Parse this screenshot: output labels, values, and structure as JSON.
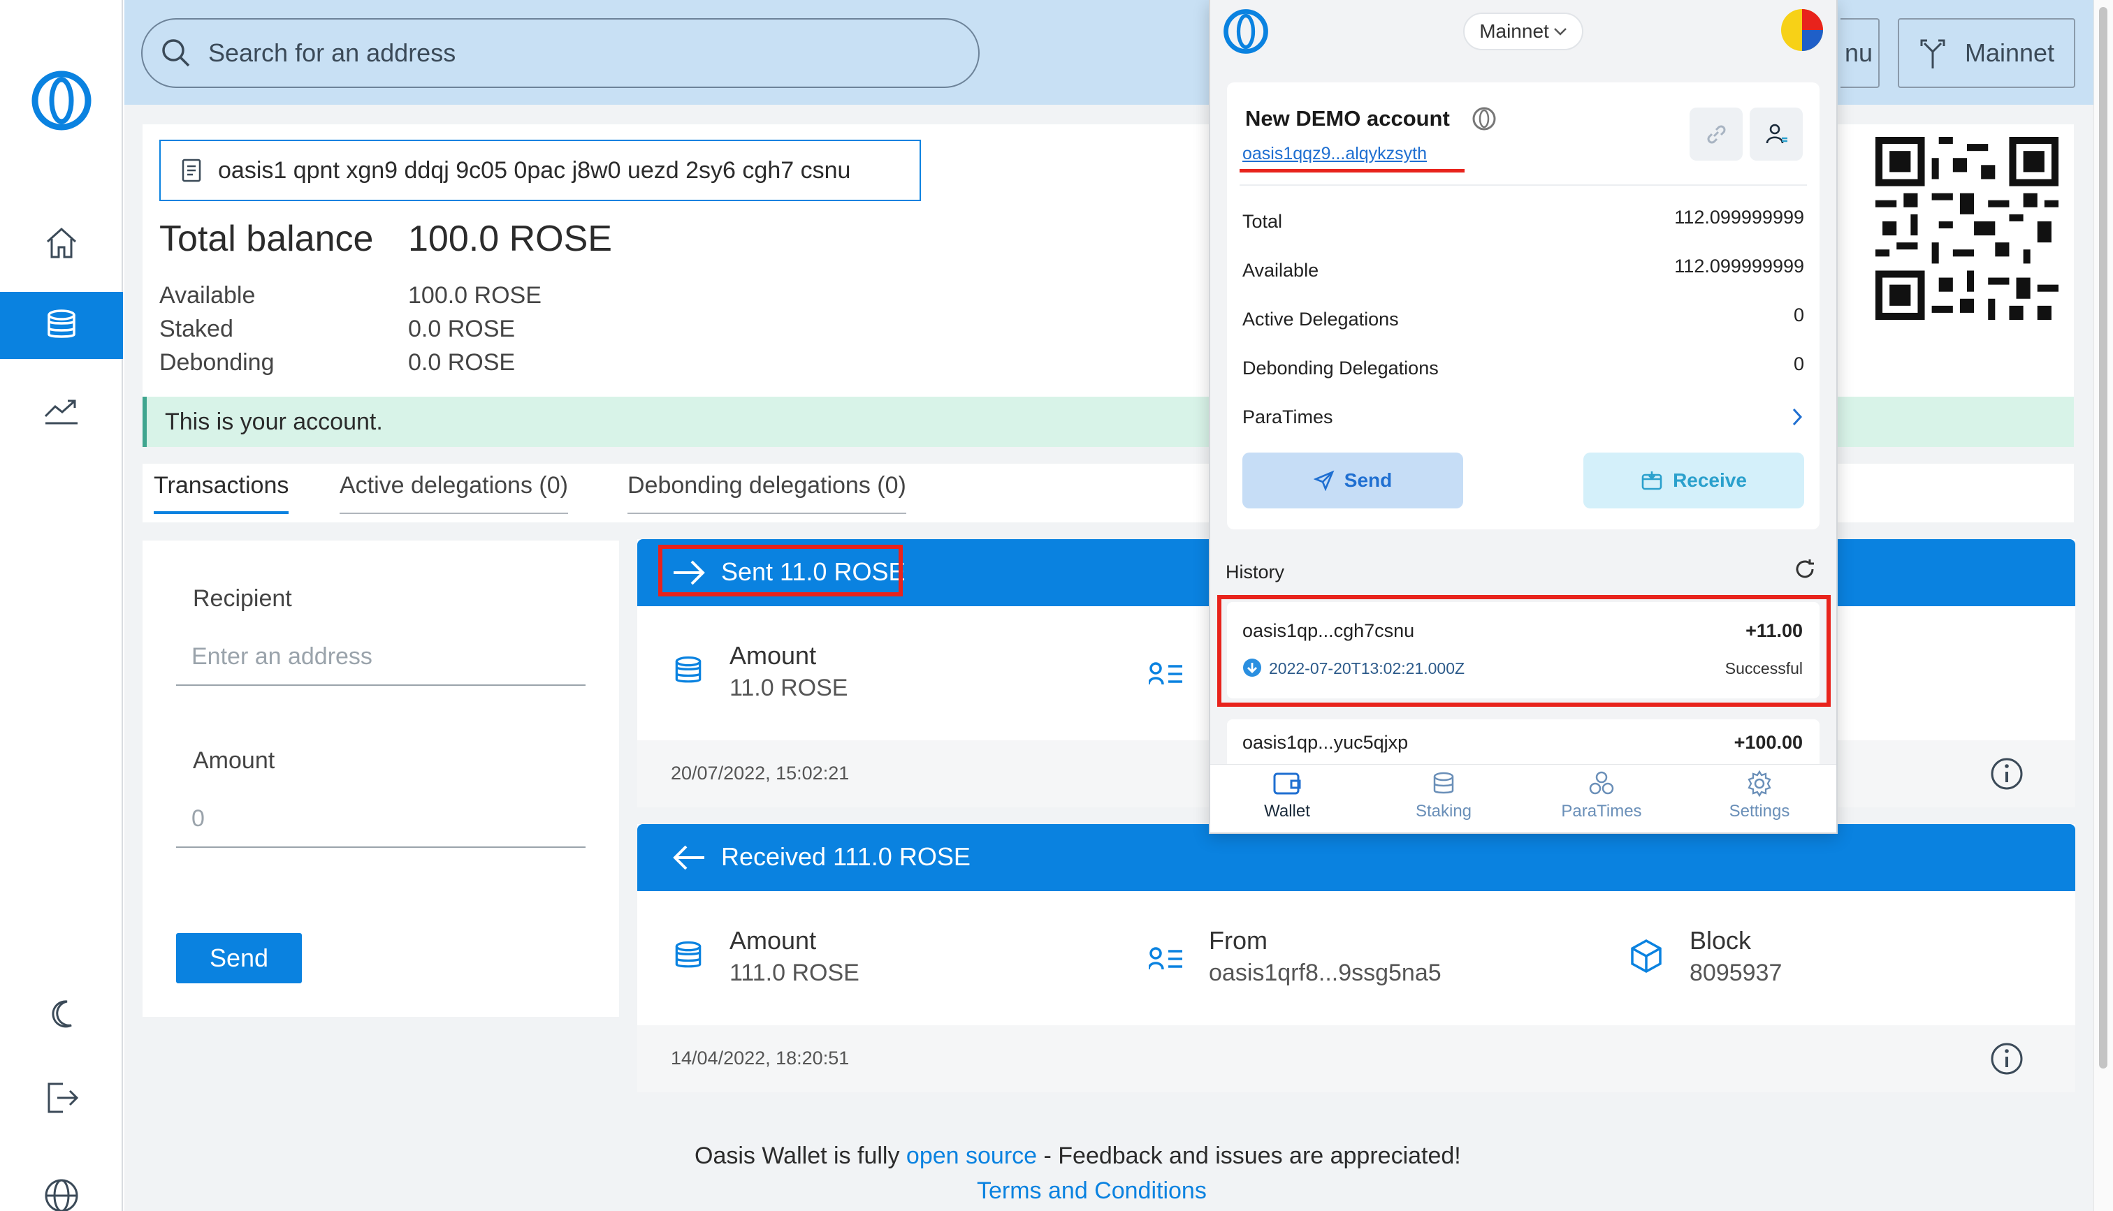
{
  "search": {
    "placeholder": "Search for an address"
  },
  "topbar": {
    "menu_partial": "nu",
    "network_label": "Mainnet"
  },
  "account": {
    "address_full": "oasis1 qpnt xgn9 ddqj 9c05 0pac j8w0 uezd 2sy6 cgh7 csnu",
    "total_label": "Total balance",
    "total_value": "100.0 ROSE",
    "rows": [
      {
        "label": "Available",
        "value": "100.0 ROSE"
      },
      {
        "label": "Staked",
        "value": "0.0 ROSE"
      },
      {
        "label": "Debonding",
        "value": "0.0 ROSE"
      }
    ],
    "notice": "This is your account."
  },
  "tabs": [
    {
      "label": "Transactions"
    },
    {
      "label": "Active delegations (0)"
    },
    {
      "label": "Debonding delegations (0)"
    }
  ],
  "send_form": {
    "recipient_label": "Recipient",
    "recipient_placeholder": "Enter an address",
    "amount_label": "Amount",
    "amount_placeholder": "0",
    "send_label": "Send"
  },
  "transactions": [
    {
      "title": "Sent 11.0 ROSE",
      "amount_label": "Amount",
      "amount_value": "11.0 ROSE",
      "date": "20/07/2022, 15:02:21"
    },
    {
      "title": "Received 111.0 ROSE",
      "amount_label": "Amount",
      "amount_value": "111.0 ROSE",
      "from_label": "From",
      "from_value": "oasis1qrf8...9ssg5na5",
      "block_label": "Block",
      "block_value": "8095937",
      "date": "14/04/2022, 18:20:51"
    }
  ],
  "footer": {
    "text_before": "Oasis Wallet is fully ",
    "link": "open source",
    "text_after": " - Feedback and issues are appreciated!",
    "terms": "Terms and Conditions"
  },
  "popup": {
    "network": "Mainnet",
    "account_name": "New DEMO account",
    "account_address": "oasis1qqz9...alqykzsyth",
    "rows": [
      {
        "label": "Total",
        "value": "112.099999999"
      },
      {
        "label": "Available",
        "value": "112.099999999"
      },
      {
        "label": "Active Delegations",
        "value": "0"
      },
      {
        "label": "Debonding Delegations",
        "value": "0"
      },
      {
        "label": "ParaTimes",
        "value": ""
      }
    ],
    "send_label": "Send",
    "receive_label": "Receive",
    "history_label": "History",
    "history": [
      {
        "address": "oasis1qp...cgh7csnu",
        "amount": "+11.00",
        "timestamp": "2022-07-20T13:02:21.000Z",
        "status": "Successful"
      },
      {
        "address": "oasis1qp...yuc5qjxp",
        "amount": "+100.00"
      }
    ],
    "nav": [
      {
        "label": "Wallet"
      },
      {
        "label": "Staking"
      },
      {
        "label": "ParaTimes"
      },
      {
        "label": "Settings"
      }
    ]
  },
  "colors": {
    "brand": "#0a82e0",
    "highlight": "#e8231c",
    "notice_bg": "#d8f3e8"
  }
}
